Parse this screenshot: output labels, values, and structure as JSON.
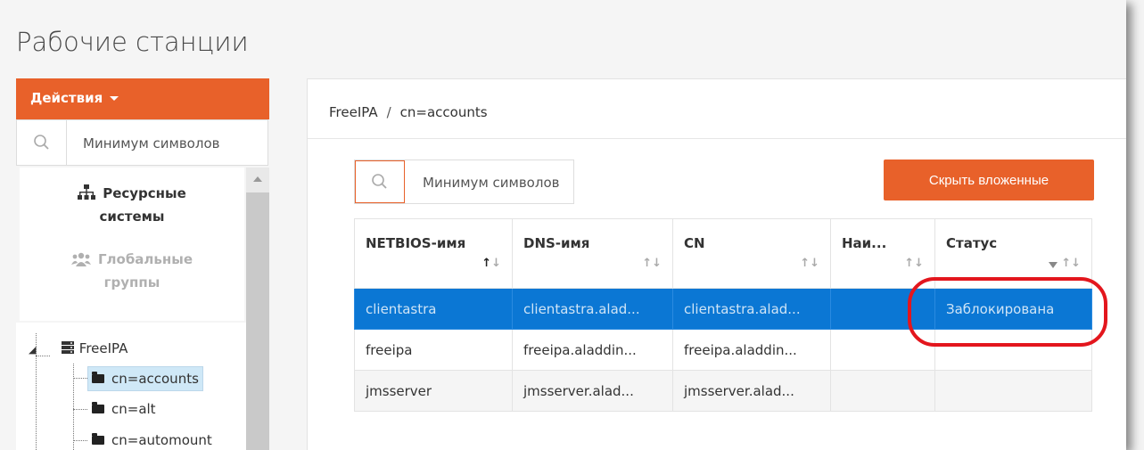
{
  "page": {
    "title": "Рабочие станции"
  },
  "sidebar": {
    "actions_label": "Действия",
    "search_placeholder": "Минимум символов",
    "nav": [
      {
        "label_line1": "Ресурсные",
        "label_line2": "системы"
      },
      {
        "label_line1": "Глобальные",
        "label_line2": "группы"
      }
    ],
    "tree": {
      "root": "FreeIPA",
      "children": [
        "cn=accounts",
        "cn=alt",
        "cn=automount"
      ]
    }
  },
  "main": {
    "breadcrumb": [
      "FreeIPA",
      "/",
      "cn=accounts"
    ],
    "search_placeholder": "Минимум символов",
    "hide_nested_label": "Скрыть вложенные",
    "columns": [
      "NETBIOS-имя",
      "DNS-имя",
      "CN",
      "Наи...",
      "Статус"
    ],
    "rows": [
      [
        "clientastra",
        "clientastra.alad...",
        "clientastra.alad...",
        "",
        "Заблокирована"
      ],
      [
        "freeipa",
        "freeipa.aladdin...",
        "freeipa.aladdin...",
        "",
        ""
      ],
      [
        "jmsserver",
        "jmsserver.alad...",
        "jmsserver.alad...",
        "",
        ""
      ]
    ]
  },
  "colors": {
    "accent": "#e8612a",
    "selected_row": "#0b77d4",
    "highlight_oval": "#e3161d"
  }
}
